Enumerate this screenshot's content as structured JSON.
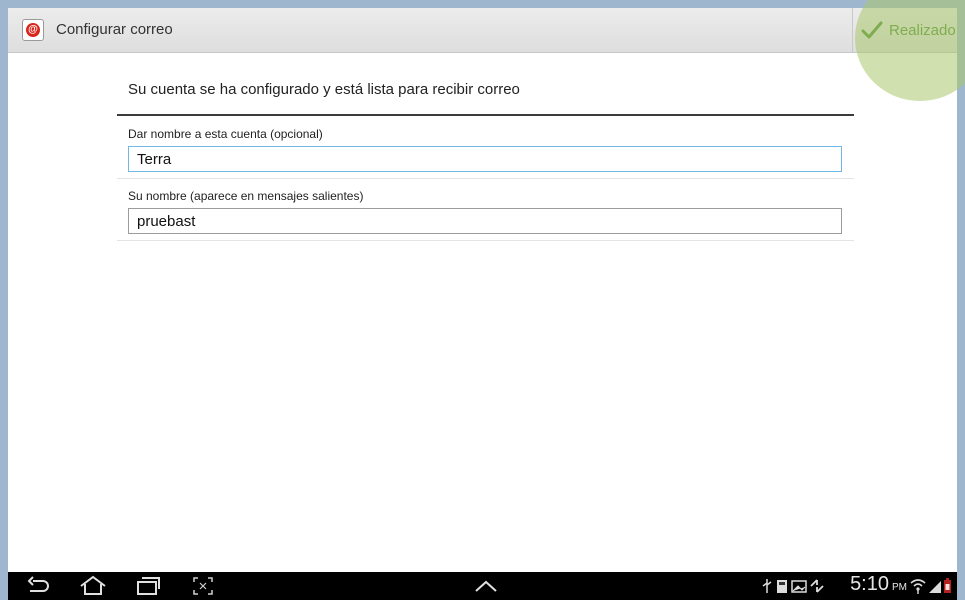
{
  "actionbar": {
    "title": "Configurar correo",
    "done_label": "Realizado",
    "app_icon": "email-app-icon"
  },
  "content": {
    "message": "Su cuenta se ha configurado y está lista para recibir correo",
    "fields": [
      {
        "label": "Dar nombre a esta cuenta (opcional)",
        "value": "Terra"
      },
      {
        "label": "Su nombre (aparece en mensajes salientes)",
        "value": "pruebast"
      }
    ]
  },
  "statusbar": {
    "time": "5:10",
    "ampm": "PM",
    "nav_icons": [
      "back-icon",
      "home-icon",
      "recent-apps-icon",
      "screenshot-icon",
      "up-chevron-icon"
    ],
    "status_icons": [
      "usb-icon",
      "sd-card-icon",
      "image-icon",
      "sync-icon",
      "wifi-icon",
      "signal-icon",
      "battery-icon"
    ]
  },
  "colors": {
    "done_accent": "#4a8a2a",
    "input_focus": "#6fb8e6",
    "app_icon_red": "#d9261c",
    "navbar": "#000000"
  }
}
